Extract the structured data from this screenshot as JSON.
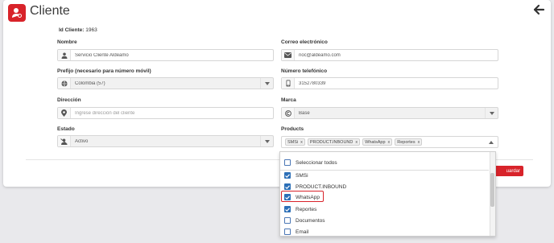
{
  "header": {
    "title": "Cliente"
  },
  "id_cliente": {
    "label": "Id Cliente:",
    "value": "1963"
  },
  "form": {
    "nombre": {
      "label": "Nombre",
      "value": "Servicio Cliente Aldeamo"
    },
    "correo": {
      "label": "Correo electrónico",
      "value": "noc@aldeamo.com"
    },
    "prefijo": {
      "label": "Prefijo (necesario para número móvil)",
      "value": "Colombia (57)"
    },
    "telefono": {
      "label": "Número telefónico",
      "value": "3152780339"
    },
    "direccion": {
      "label": "Dirección",
      "placeholder": "Ingrese dirección del cliente"
    },
    "marca": {
      "label": "Marca",
      "value": "Base"
    },
    "estado": {
      "label": "Estado",
      "value": "Activo"
    },
    "products": {
      "label": "Products",
      "tags": [
        "SMSi",
        "PRODUCT.INBOUND",
        "WhatsApp",
        "Reportes"
      ],
      "tag_remove": "x"
    }
  },
  "save_label": "uardar",
  "dropdown": {
    "select_all": "Seleccionar todos",
    "options": [
      {
        "label": "SMSi",
        "checked": true
      },
      {
        "label": "PRODUCT.INBOUND",
        "checked": true
      },
      {
        "label": "WhatsApp",
        "checked": true
      },
      {
        "label": "Reportes",
        "checked": true
      },
      {
        "label": "Documentos",
        "checked": false
      },
      {
        "label": "Email",
        "checked": false
      }
    ]
  },
  "colors": {
    "accent": "#d8232a",
    "checkbox": "#2c6fb7"
  }
}
